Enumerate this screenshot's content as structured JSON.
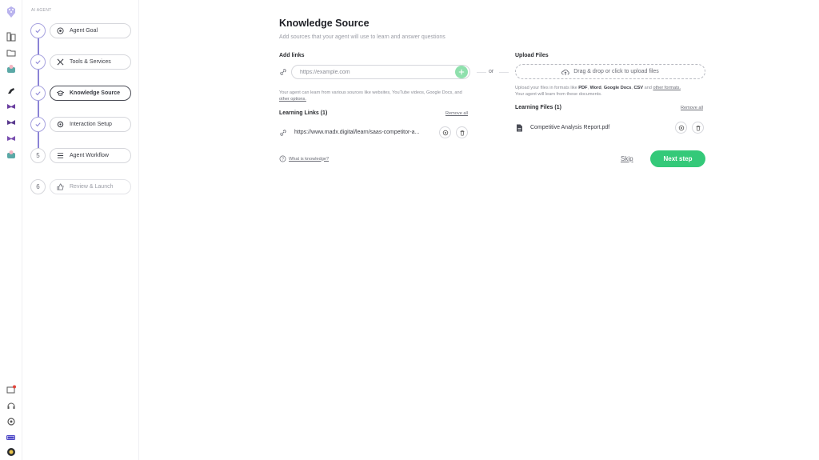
{
  "sidebar": {
    "section_label": "AI AGENT",
    "steps": [
      {
        "label": "Agent Goal",
        "state": "done"
      },
      {
        "label": "Tools & Services",
        "state": "done"
      },
      {
        "label": "Knowledge Source",
        "state": "active"
      },
      {
        "label": "Interaction Setup",
        "state": "done"
      },
      {
        "label": "Agent Workflow",
        "state": "pending",
        "number": "5"
      },
      {
        "label": "Review & Launch",
        "state": "disabled",
        "number": "6"
      }
    ]
  },
  "header": {
    "title": "Knowledge Source",
    "subtitle": "Add sources that your agent will use to learn and answer questions"
  },
  "links": {
    "heading": "Add links",
    "input_placeholder": "https://example.com",
    "or_label": "or",
    "help_prefix": "Your agent can learn from various sources like websites, YouTube videos, Google Docs, and ",
    "help_link": "other options.",
    "list_heading": "Learning Links (1)",
    "remove_all": "Remove all",
    "items": [
      {
        "text": "https://www.madx.digital/learn/saas-competitor-a..."
      }
    ]
  },
  "files": {
    "heading": "Upload Files",
    "drop_label": "Drag & drop or click to upload files",
    "help_prefix": "Upload your files in formats like ",
    "formats": [
      "PDF",
      "Word",
      "Google Docs",
      "CSV"
    ],
    "help_and": "and",
    "help_link": "other formats.",
    "help_line2": "Your agent will learn from these documents.",
    "list_heading": "Learning Files (1)",
    "remove_all": "Remove all",
    "items": [
      {
        "text": "Competitive Analysis Report.pdf"
      }
    ]
  },
  "footer": {
    "what_is": "What is knowledge?",
    "skip": "Skip",
    "next": "Next step"
  },
  "colors": {
    "accent_purple": "#8b83d6",
    "primary_green": "#34c979"
  }
}
